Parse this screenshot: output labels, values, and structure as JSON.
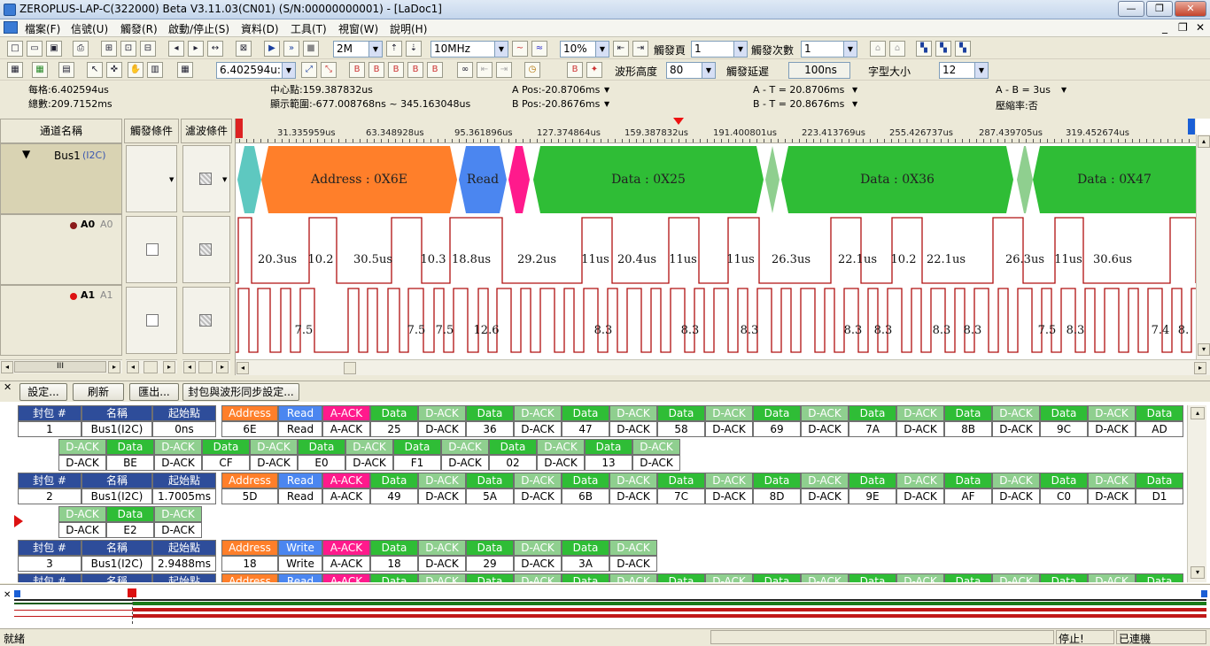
{
  "window": {
    "title": "ZEROPLUS-LAP-C(322000) Beta V3.11.03(CN01) (S/N:00000000001) - [LaDoc1]",
    "btn_min": "—",
    "btn_max": "❐",
    "btn_close": "✕",
    "mdi_min": "_",
    "mdi_restore": "❐",
    "mdi_close": "✕"
  },
  "menu": [
    "檔案(F)",
    "信號(U)",
    "觸發(R)",
    "啟動/停止(S)",
    "資料(D)",
    "工具(T)",
    "視窗(W)",
    "說明(H)"
  ],
  "toolbar1": {
    "mem": "2M",
    "rate": "10MHz",
    "pct": "10%",
    "trig_page_label": "觸發頁",
    "trig_page": "1",
    "trig_count_label": "觸發次數",
    "trig_count": "1"
  },
  "toolbar2": {
    "time": "6.402594u:",
    "wave_height_label": "波形高度",
    "wave_height": "80",
    "trig_delay_label": "觸發延遲",
    "trig_delay": "100ns",
    "font_size_label": "字型大小",
    "font_size": "12"
  },
  "info": {
    "grid": "每格:6.402594us",
    "total": "總數:209.7152ms",
    "center": "中心點:159.387832us",
    "range": "顯示範圍:-677.008768ns ~ 345.163048us",
    "apos": "A Pos:-20.8706ms",
    "bpos": "B Pos:-20.8676ms",
    "at": "A - T = 20.8706ms",
    "bt": "B - T = 20.8676ms",
    "ab": "A - B = 3us",
    "compress": "壓縮率:否"
  },
  "channel_header": {
    "name": "通道名稱",
    "trigger": "觸發條件",
    "filter": "濾波條件"
  },
  "channels": [
    {
      "name": "Bus1",
      "sub": "(I2C)"
    },
    {
      "name": "A0",
      "sub": "A0"
    },
    {
      "name": "A1",
      "sub": "A1"
    }
  ],
  "scroll_label": "III",
  "ruler_labels": [
    "31.335959us",
    "63.348928us",
    "95.361896us",
    "127.374864us",
    "159.387832us",
    "191.400801us",
    "223.413769us",
    "255.426737us",
    "287.439705us",
    "319.452674us"
  ],
  "bus_segments": [
    {
      "label": "",
      "kind": "start"
    },
    {
      "label": "Address : 0X6E",
      "kind": "addr"
    },
    {
      "label": "Read",
      "kind": "rw"
    },
    {
      "label": "",
      "kind": "ack"
    },
    {
      "label": "Data : 0X25",
      "kind": "data"
    },
    {
      "label": "",
      "kind": "dack"
    },
    {
      "label": "Data : 0X36",
      "kind": "data"
    },
    {
      "label": "",
      "kind": "dack"
    },
    {
      "label": "Data : 0X47",
      "kind": "data"
    }
  ],
  "a0_labels": [
    "20.3us",
    "10.2",
    "30.5us",
    "10.3",
    "18.8us",
    "29.2us",
    "11us",
    "20.4us",
    "11us",
    "11us",
    "26.3us",
    "22.1us",
    "10.2",
    "22.1us",
    "26.3us",
    "11us",
    "30.6us"
  ],
  "a1_labels": [
    "7.5",
    "7.5",
    "7.5",
    "12.6",
    "8.3",
    "8.3",
    "8.3",
    "8.3",
    "8.3",
    "8.3",
    "8.3",
    "7.5",
    "8.3",
    "7.4",
    "8."
  ],
  "buttons": {
    "settings": "設定...",
    "refresh": "刷新",
    "export": "匯出...",
    "sync": "封包與波形同步設定..."
  },
  "packet_header": {
    "num": "封包 #",
    "name": "名稱",
    "start": "起始點"
  },
  "packets": [
    {
      "num": "1",
      "name": "Bus1(I2C)",
      "start": "0ns",
      "fields": [
        [
          "Address",
          "6E"
        ],
        [
          "Read",
          "Read"
        ],
        [
          "A-ACK",
          "A-ACK"
        ],
        [
          "Data",
          "25"
        ],
        [
          "D-ACK",
          "D-ACK"
        ],
        [
          "Data",
          "36"
        ],
        [
          "D-ACK",
          "D-ACK"
        ],
        [
          "Data",
          "47"
        ],
        [
          "D-ACK",
          "D-ACK"
        ],
        [
          "Data",
          "58"
        ],
        [
          "D-ACK",
          "D-ACK"
        ],
        [
          "Data",
          "69"
        ],
        [
          "D-ACK",
          "D-ACK"
        ],
        [
          "Data",
          "7A"
        ],
        [
          "D-ACK",
          "D-ACK"
        ],
        [
          "Data",
          "8B"
        ],
        [
          "D-ACK",
          "D-ACK"
        ],
        [
          "Data",
          "9C"
        ],
        [
          "D-ACK",
          "D-ACK"
        ],
        [
          "Data",
          "AD"
        ]
      ],
      "cont": [
        [
          "D-ACK",
          "D-ACK"
        ],
        [
          "Data",
          "BE"
        ],
        [
          "D-ACK",
          "D-ACK"
        ],
        [
          "Data",
          "CF"
        ],
        [
          "D-ACK",
          "D-ACK"
        ],
        [
          "Data",
          "E0"
        ],
        [
          "D-ACK",
          "D-ACK"
        ],
        [
          "Data",
          "F1"
        ],
        [
          "D-ACK",
          "D-ACK"
        ],
        [
          "Data",
          "02"
        ],
        [
          "D-ACK",
          "D-ACK"
        ],
        [
          "Data",
          "13"
        ],
        [
          "D-ACK",
          "D-ACK"
        ]
      ]
    },
    {
      "num": "2",
      "name": "Bus1(I2C)",
      "start": "1.7005ms",
      "fields": [
        [
          "Address",
          "5D"
        ],
        [
          "Read",
          "Read"
        ],
        [
          "A-ACK",
          "A-ACK"
        ],
        [
          "Data",
          "49"
        ],
        [
          "D-ACK",
          "D-ACK"
        ],
        [
          "Data",
          "5A"
        ],
        [
          "D-ACK",
          "D-ACK"
        ],
        [
          "Data",
          "6B"
        ],
        [
          "D-ACK",
          "D-ACK"
        ],
        [
          "Data",
          "7C"
        ],
        [
          "D-ACK",
          "D-ACK"
        ],
        [
          "Data",
          "8D"
        ],
        [
          "D-ACK",
          "D-ACK"
        ],
        [
          "Data",
          "9E"
        ],
        [
          "D-ACK",
          "D-ACK"
        ],
        [
          "Data",
          "AF"
        ],
        [
          "D-ACK",
          "D-ACK"
        ],
        [
          "Data",
          "C0"
        ],
        [
          "D-ACK",
          "D-ACK"
        ],
        [
          "Data",
          "D1"
        ]
      ],
      "cont": [
        [
          "D-ACK",
          "D-ACK"
        ],
        [
          "Data",
          "E2"
        ],
        [
          "D-ACK",
          "D-ACK"
        ]
      ]
    },
    {
      "num": "3",
      "name": "Bus1(I2C)",
      "start": "2.9488ms",
      "fields": [
        [
          "Address",
          "18"
        ],
        [
          "Write",
          "Write"
        ],
        [
          "A-ACK",
          "A-ACK"
        ],
        [
          "Data",
          "18"
        ],
        [
          "D-ACK",
          "D-ACK"
        ],
        [
          "Data",
          "29"
        ],
        [
          "D-ACK",
          "D-ACK"
        ],
        [
          "Data",
          "3A"
        ],
        [
          "D-ACK",
          "D-ACK"
        ]
      ],
      "cont": []
    },
    {
      "num": "",
      "name": "",
      "start": "",
      "fields": [
        [
          "Address",
          ""
        ],
        [
          "Read",
          ""
        ],
        [
          "A-ACK",
          ""
        ],
        [
          "Data",
          ""
        ],
        [
          "D-ACK",
          ""
        ],
        [
          "Data",
          ""
        ],
        [
          "D-ACK",
          ""
        ],
        [
          "Data",
          ""
        ],
        [
          "D-ACK",
          ""
        ],
        [
          "Data",
          ""
        ],
        [
          "D-ACK",
          ""
        ],
        [
          "Data",
          ""
        ],
        [
          "D-ACK",
          ""
        ],
        [
          "Data",
          ""
        ],
        [
          "D-ACK",
          ""
        ],
        [
          "Data",
          ""
        ],
        [
          "D-ACK",
          ""
        ],
        [
          "Data",
          ""
        ],
        [
          "D-ACK",
          ""
        ],
        [
          "Data",
          ""
        ]
      ],
      "cont": []
    }
  ],
  "status": {
    "ready": "就緒",
    "stopped": "停止!",
    "connected": "已連機"
  },
  "colors": {
    "addr": "#ff7f2a",
    "rw": "#4b86f0",
    "ack": "#ff1a8c",
    "data": "#2fbd36",
    "dack": "#8fcf8f",
    "start": "#5ec8c0",
    "wave": "#b01010"
  }
}
